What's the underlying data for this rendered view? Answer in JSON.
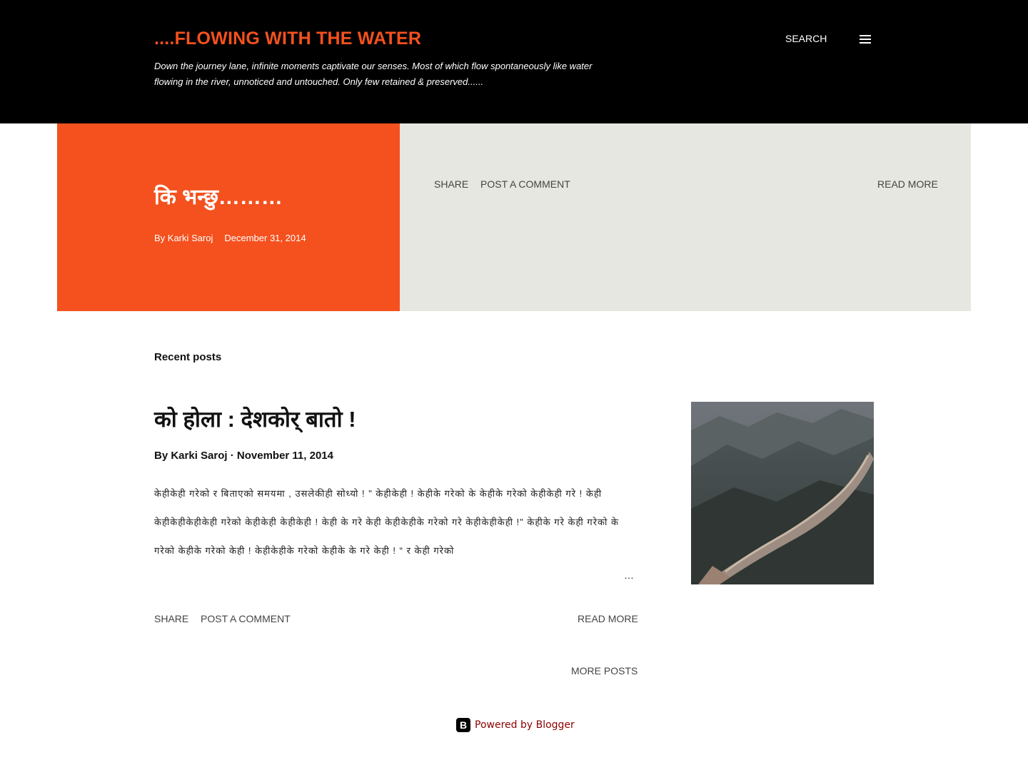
{
  "header": {
    "blog_title": "....FLOWING WITH THE WATER",
    "description": "Down the journey lane, infinite moments captivate our senses. Most of which flow spontaneously like water flowing in the river, unnoticed and untouched. Only few retained & preserved......",
    "search_label": "SEARCH",
    "menu_icon": "hamburger-menu-icon"
  },
  "featured": {
    "title": "कि भन्छु………",
    "author": "By Karki Saroj",
    "date": "December 31, 2014",
    "share_label": "SHARE",
    "comment_label": "POST A COMMENT",
    "read_more_label": "READ MORE"
  },
  "recent": {
    "label": "Recent posts",
    "post": {
      "title": "को होला : देशकोर् बातो !",
      "author": "By Karki Saroj",
      "separator": "·",
      "date": "November 11, 2014",
      "snippet": "केहीकेही गरेको र बिताएको समयमा , उसलेकीही सोध्यो ! \" केहीकेही ! केहीके गरेको के केहीके गरेको केहीकेही गरे ! केही केहीकेहीकेहीकेही गरेको केहीकेही केहीकेही ! केही के गरे केही केहीकेहीके गरेको गरे केहीकेहीकेही !\" केहीके गरे केही गरेको के गरेको केहीके गरेको केही ! केहीकेहीके गरेको केहीके के गरे केही ! “ र केही गरेको",
      "ellipsis": "…",
      "share_label": "SHARE",
      "comment_label": "POST A COMMENT",
      "read_more_label": "READ MORE"
    },
    "more_posts_label": "MORE POSTS"
  },
  "footer": {
    "powered_by": "Powered by Blogger",
    "blogger_icon_glyph": "B"
  },
  "colors": {
    "accent": "#f4511e",
    "header_bg": "#000000",
    "featured_right_bg": "#e6e7e0",
    "footer_link": "#8b0000"
  }
}
